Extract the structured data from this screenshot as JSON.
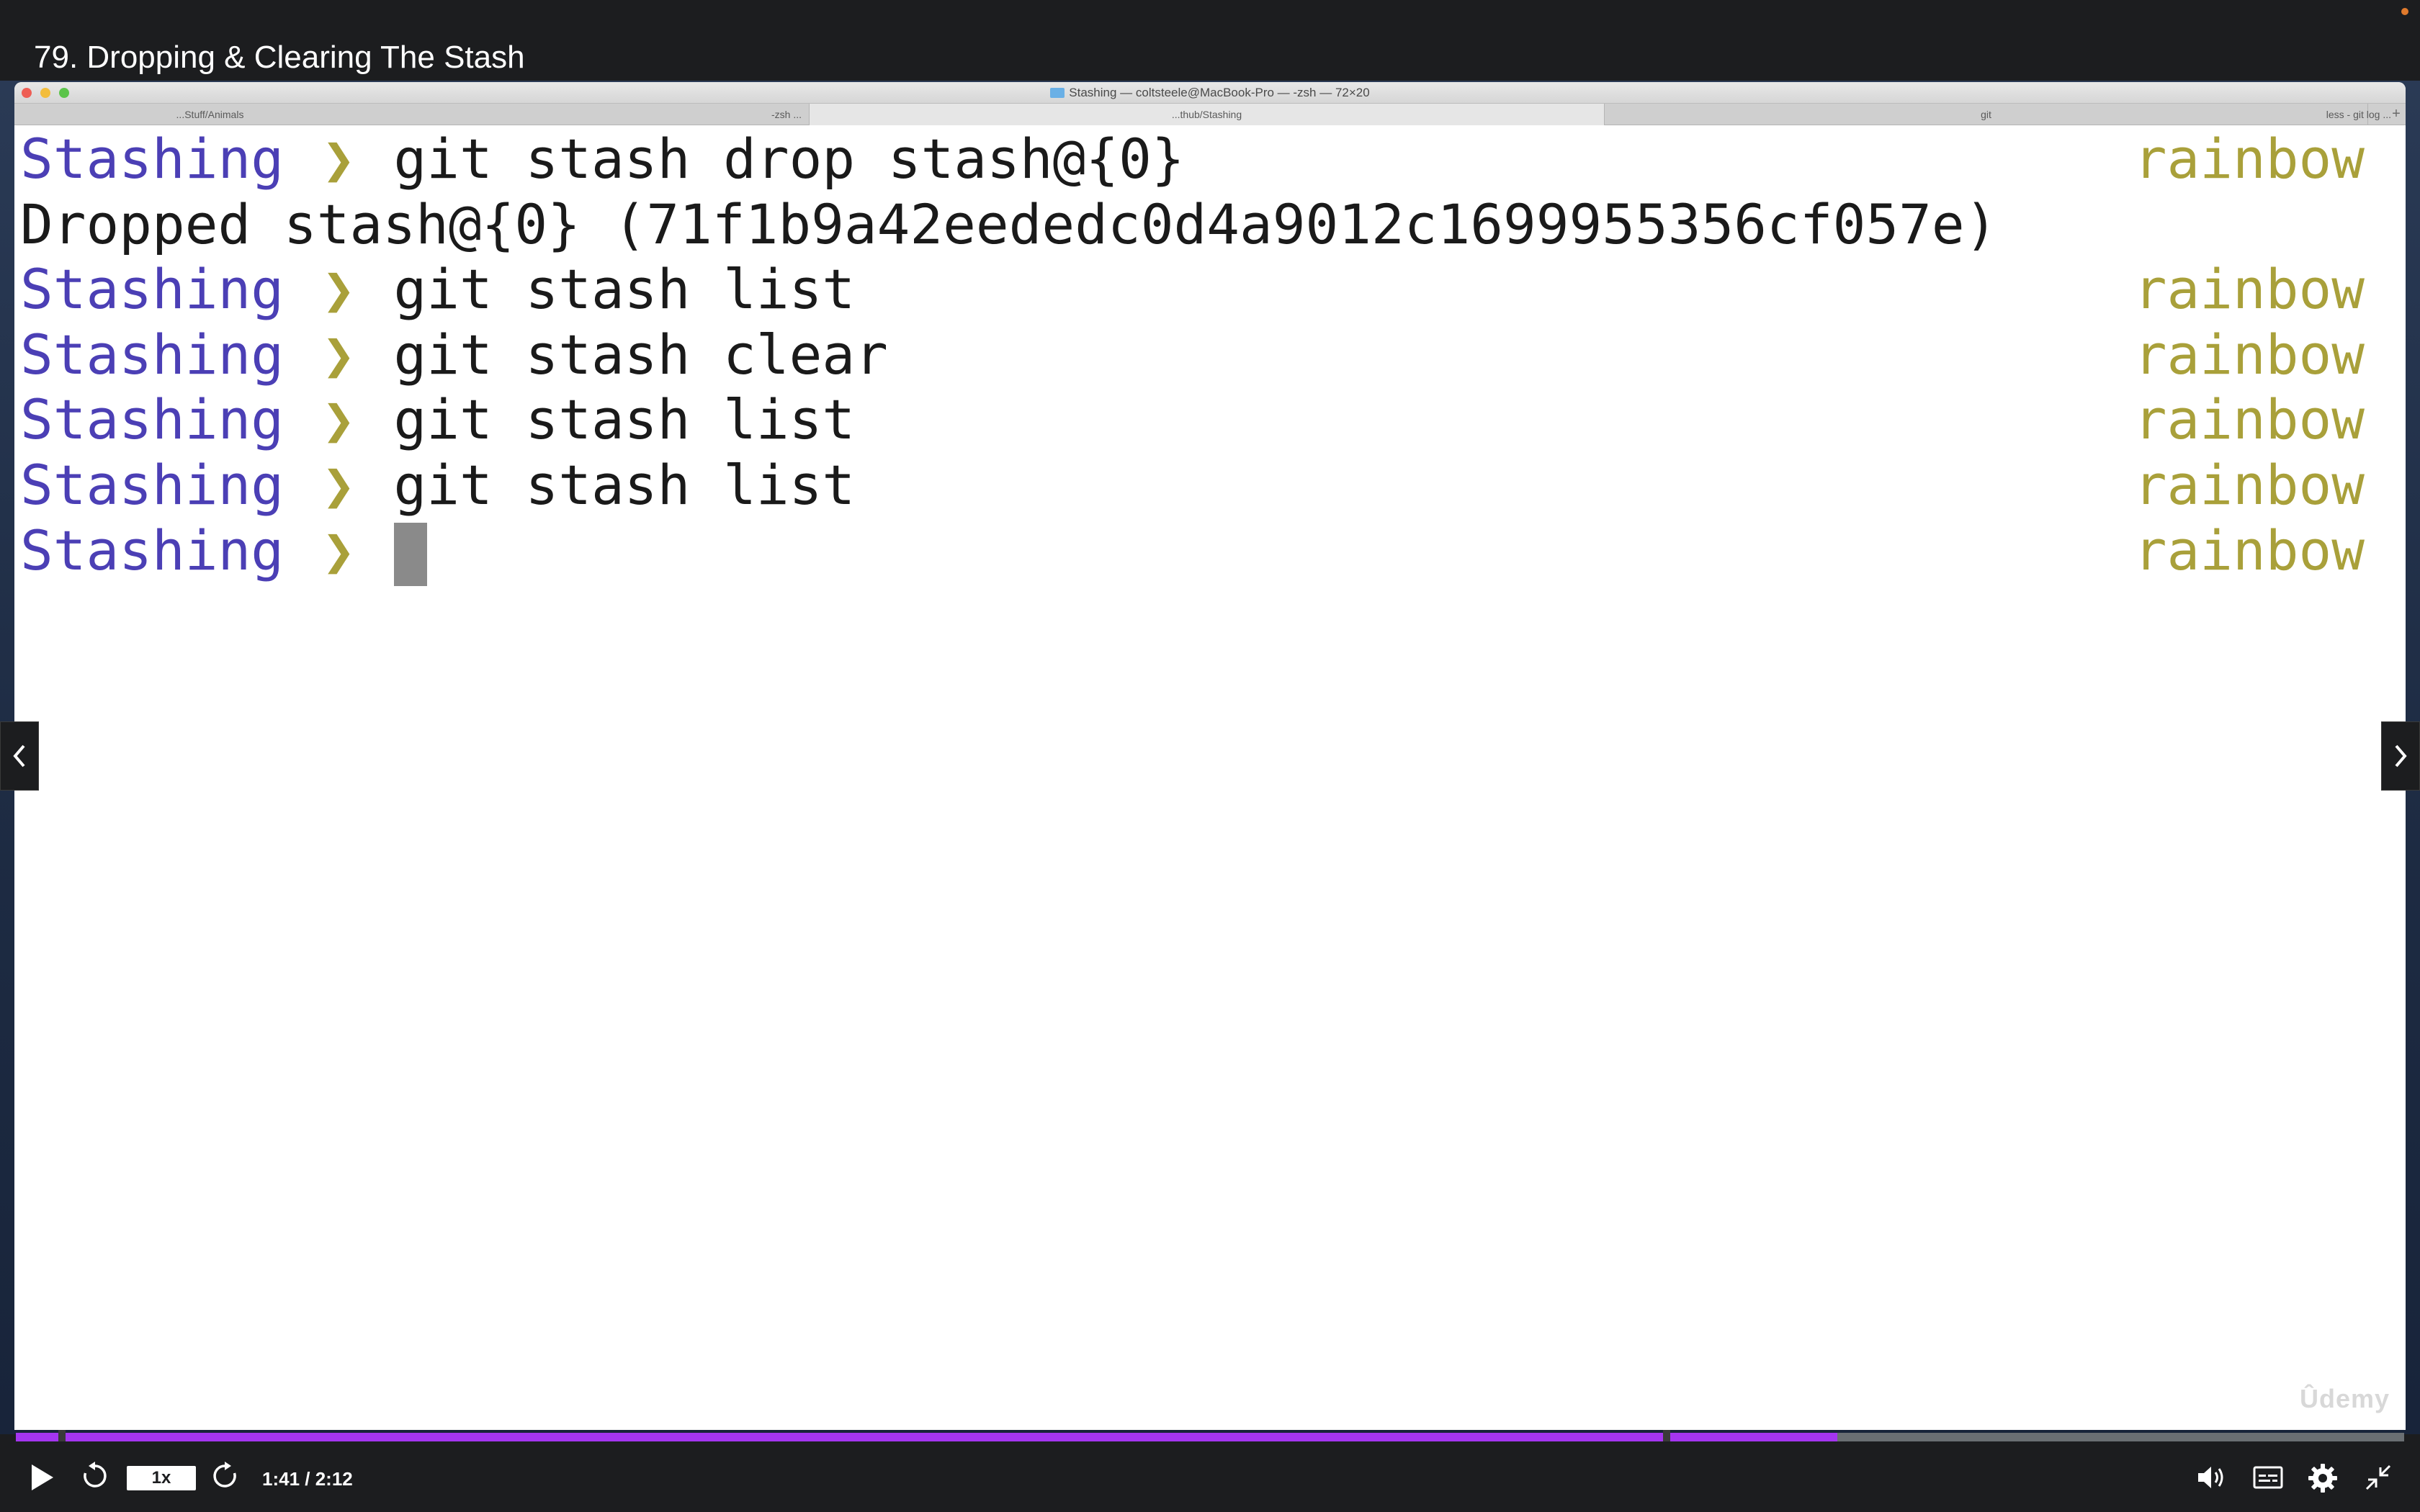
{
  "player": {
    "lecture_title": "79. Dropping & Clearing The Stash",
    "progress_fraction": 0.7627,
    "bookmark_fractions": [
      0.0177,
      0.6896
    ],
    "speed_label": "1x",
    "time_display": "1:41 / 2:12",
    "accent_color": "#a435f0",
    "watermark": "Ûdemy"
  },
  "terminal": {
    "window_title": "Stashing — coltsteele@MacBook-Pro — -zsh — 72×20",
    "tabs": [
      {
        "label": "...Stuff/Animals",
        "right_label": "-zsh ...",
        "active": false
      },
      {
        "label": "...thub/Stashing",
        "right_label": "",
        "active": true
      },
      {
        "label": "git",
        "right_label": "",
        "active": false
      },
      {
        "label": "",
        "right_label": "less - git log ...",
        "active": false
      }
    ],
    "prompt_dir": "Stashing",
    "prompt_arrow": "❯",
    "right_prompt": "rainbow",
    "lines": [
      {
        "kind": "prompt",
        "cmd": "git stash drop stash@{0}"
      },
      {
        "kind": "output",
        "text": "Dropped stash@{0} (71f1b9a42eededc0d4a9012c1699955356cf057e)"
      },
      {
        "kind": "prompt",
        "cmd": "git stash list"
      },
      {
        "kind": "prompt",
        "cmd": "git stash clear"
      },
      {
        "kind": "prompt",
        "cmd": "git stash list"
      },
      {
        "kind": "prompt",
        "cmd": "git stash list"
      },
      {
        "kind": "prompt",
        "cmd": "",
        "cursor": true
      }
    ],
    "colors": {
      "prompt_dir": "#4b3fb5",
      "prompt_arrow": "#a9a03a",
      "right_prompt": "#a9a03a"
    }
  },
  "icons": {
    "play": "play-icon",
    "rewind": "rewind-icon",
    "forward": "forward-icon",
    "volume": "volume-icon",
    "captions": "captions-icon",
    "settings": "gear-icon",
    "fullscreen": "exit-fullscreen-icon"
  }
}
